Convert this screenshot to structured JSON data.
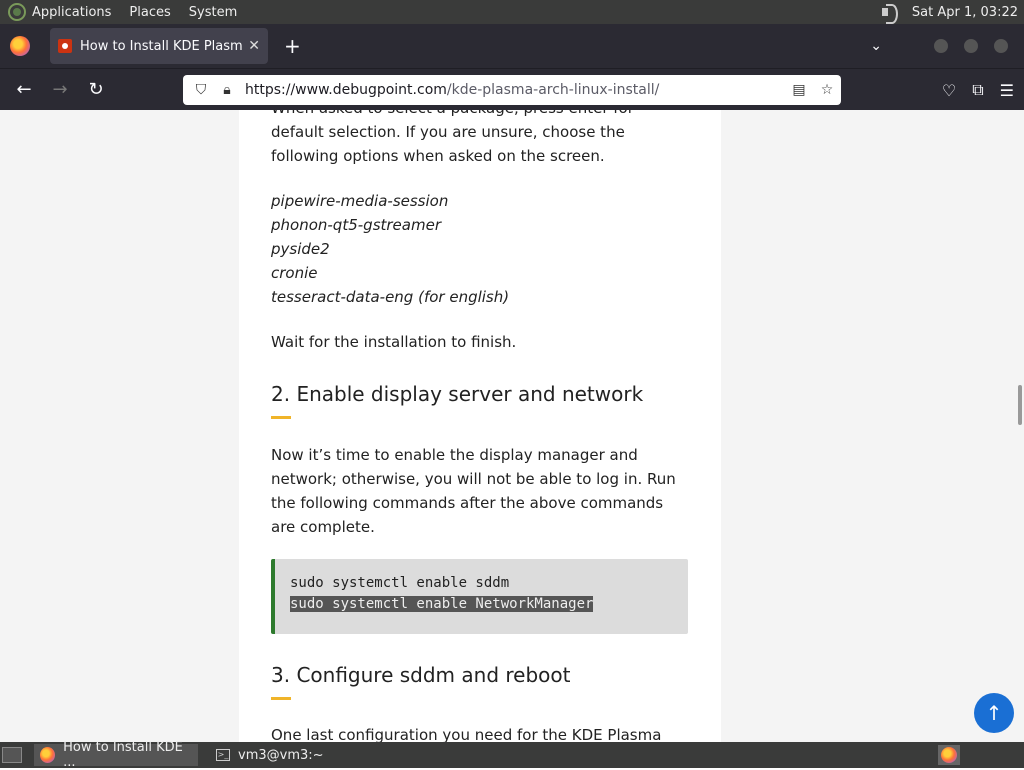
{
  "top_panel": {
    "menus": [
      "Applications",
      "Places",
      "System"
    ],
    "clock": "Sat Apr  1, 03:22"
  },
  "browser": {
    "tab_title": "How to Install KDE Plasma i",
    "new_tab": "+",
    "url_domain": "https://www.debugpoint.com",
    "url_path": "/kde-plasma-arch-linux-install/"
  },
  "article": {
    "intro": "When asked to select a package, press enter for default selection. If you are unsure, choose the following options when asked on the screen.",
    "packages": [
      "pipewire-media-session",
      "phonon-qt5-gstreamer",
      "pyside2",
      "cronie",
      "tesseract-data-eng (for english)"
    ],
    "wait": "Wait for the installation to finish.",
    "heading2": "2. Enable display server and network",
    "para2": "Now it’s time to enable the display manager and network; otherwise, you will not be able to log in. Run the following commands after the above commands are complete.",
    "code_line1": "sudo systemctl enable sddm",
    "code_line2": "sudo systemctl enable NetworkManager",
    "heading3": "3. Configure sddm and reboot",
    "para3": "One last configuration you need for the KDE Plasma"
  },
  "taskbar": {
    "task1": "How to Install KDE ...",
    "task2": "vm3@vm3:~"
  },
  "colors": {
    "accent_bar": "#f0b429",
    "code_border": "#2d7a2d",
    "to_top_button": "#1a6fd4"
  }
}
